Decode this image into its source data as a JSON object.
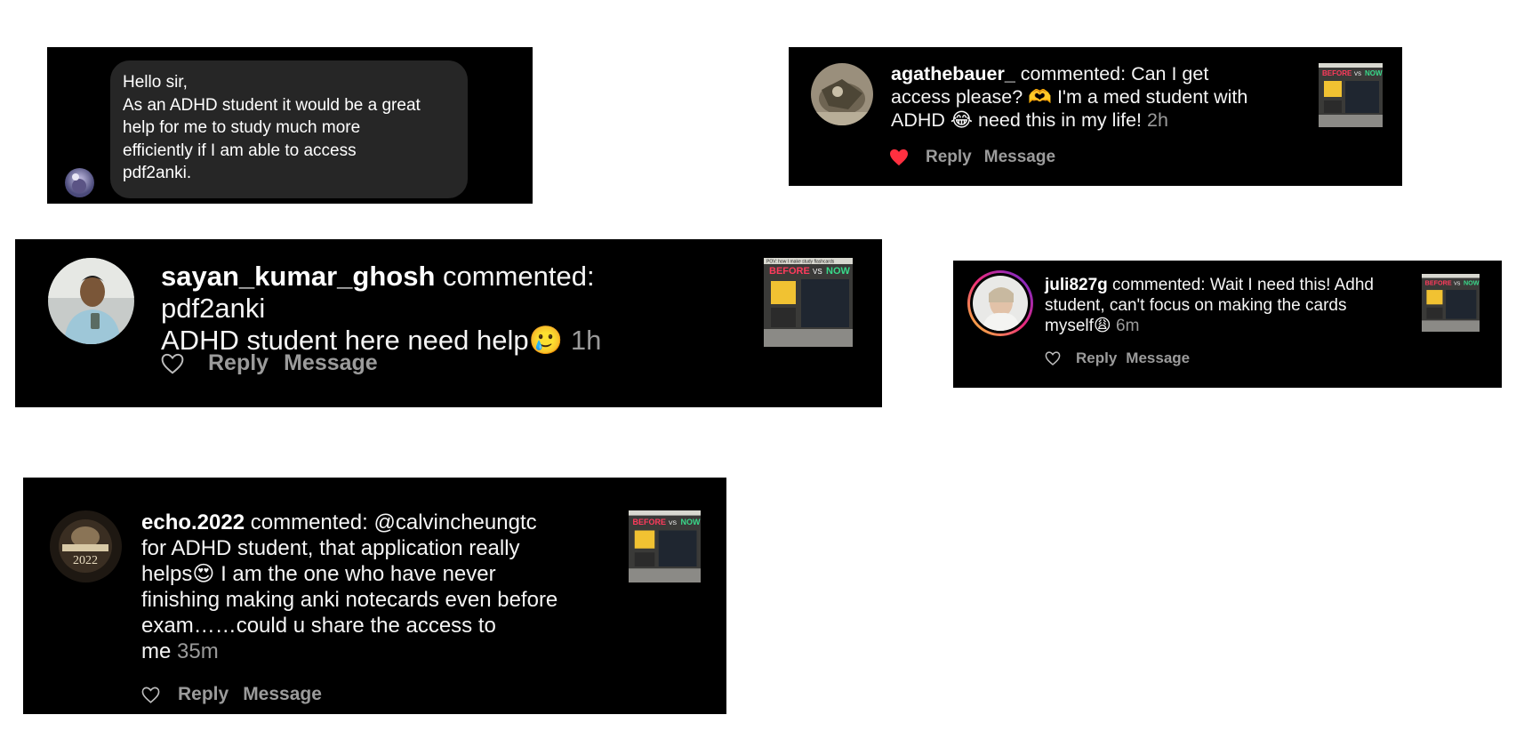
{
  "dm": {
    "avatar": "user-avatar",
    "lines": [
      "Hello sir,",
      "As an ADHD student it would be a great",
      "help for me to study much more",
      "efficiently if I am able  to access",
      "pdf2anki."
    ]
  },
  "comment_agathe": {
    "avatar": "user-avatar",
    "username": "agathebauer_",
    "line1": "commented: Can I get",
    "line2a": "access please? ",
    "emoji1": "🫶",
    "line2b": " I'm a med student with",
    "line3a": "ADHD ",
    "emoji2": "😂",
    "line3b": " need this in my life!",
    "time": "2h",
    "liked": true,
    "reply_label": "Reply",
    "message_label": "Message",
    "heart_color": "#ff3040"
  },
  "comment_sayan": {
    "avatar": "user-avatar",
    "username": "sayan_kumar_ghosh",
    "line1": "commented: pdf2anki",
    "line2": "ADHD student here need help",
    "emoji": "🥲",
    "time": "1h",
    "reply_label": "Reply",
    "message_label": "Message"
  },
  "comment_juli": {
    "avatar": "user-avatar",
    "username": "juli827g",
    "line1": "commented: Wait I need this! Adhd",
    "line2": "student, can't focus on making the cards",
    "line3": "myself",
    "emoji": "😩",
    "time": "6m",
    "reply_label": "Reply",
    "message_label": "Message",
    "story_ring_colors": [
      "#f9ce34",
      "#ee2a7b",
      "#6228d7"
    ]
  },
  "comment_echo": {
    "avatar": "user-avatar",
    "username": "echo.2022",
    "line1": "commented: @calvincheungtc",
    "line2": "for ADHD student, that application really",
    "line3a": "helps",
    "emoji": "😍",
    "line3b": " I am the one who have never",
    "line4": "finishing making anki notecards even before",
    "line5": "exam……could u share the access to",
    "line6": "me",
    "time": "35m",
    "reply_label": "Reply",
    "message_label": "Message"
  },
  "post_thumbnail": {
    "caption": "POV: how I make study flashcards",
    "before": "BEFORE",
    "vs": "VS",
    "now": "NOW",
    "before_color": "#ff3b5c",
    "now_color": "#39d98a",
    "icon": "post-thumbnail"
  }
}
